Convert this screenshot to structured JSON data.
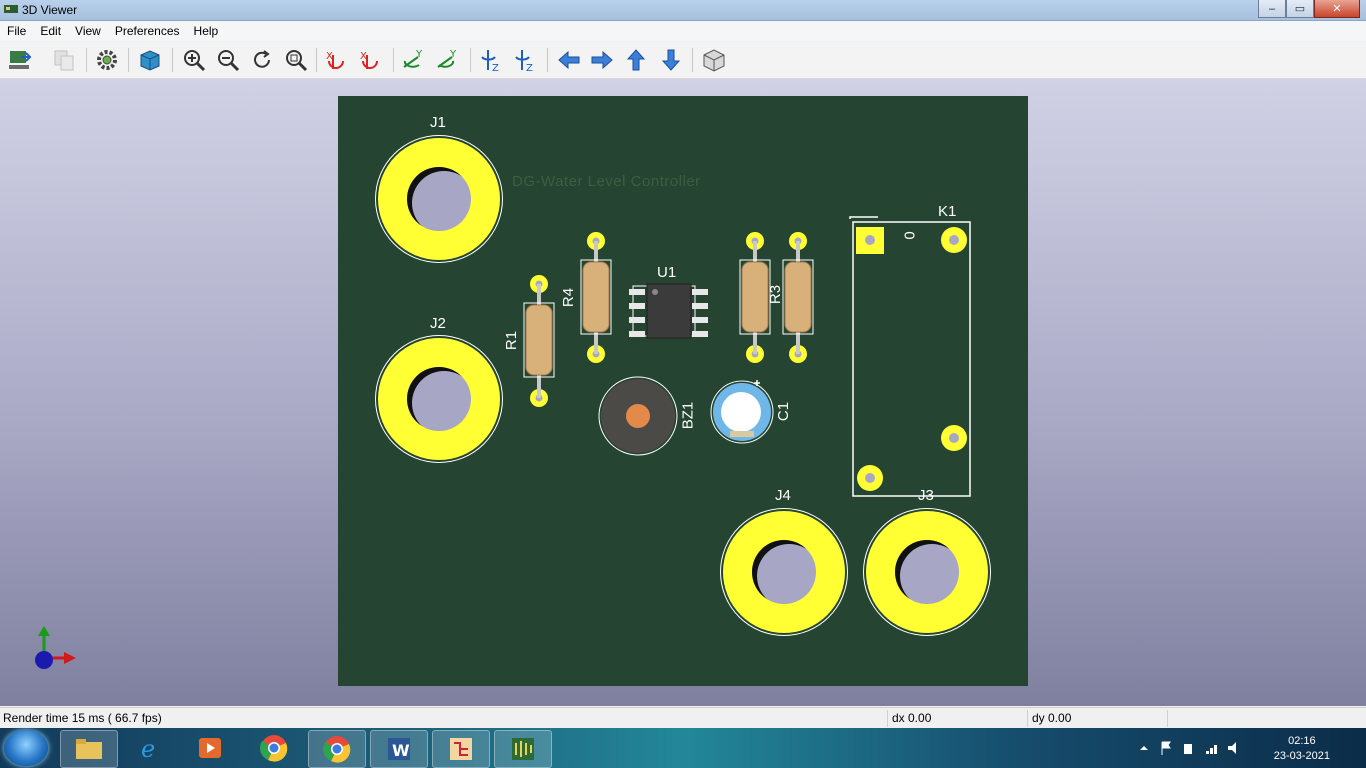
{
  "window": {
    "title": "3D Viewer",
    "controls": {
      "minimize": "–",
      "maximize": "▭",
      "close": "✕"
    }
  },
  "menu": [
    "File",
    "Edit",
    "View",
    "Preferences",
    "Help"
  ],
  "toolbar": [
    "reload-board-icon",
    "copy-image-icon",
    "settings-icon",
    "orthographic-view-icon",
    "zoom-in-icon",
    "zoom-out-icon",
    "redraw-icon",
    "zoom-fit-icon",
    "rotate-x-cw-icon",
    "rotate-x-ccw-icon",
    "rotate-y-cw-icon",
    "rotate-y-ccw-icon",
    "rotate-z-cw-icon",
    "rotate-z-ccw-icon",
    "move-left-icon",
    "move-right-icon",
    "move-up-icon",
    "move-down-icon",
    "view-3d-box-icon"
  ],
  "pcb": {
    "board_text": "DG-Water Level Controller",
    "refs": {
      "J1": "J1",
      "J2": "J2",
      "J3": "J3",
      "J4": "J4",
      "K1": "K1",
      "U1": "U1",
      "R1": "R1",
      "R4": "R4",
      "R3": "R3",
      "BZ1": "BZ1",
      "C1": "C1",
      "k1_pin": "0"
    },
    "colors": {
      "board": "#254431",
      "copper": "#ffff33",
      "silk": "#ffffff"
    }
  },
  "status": {
    "render_time": "Render time 15 ms ( 66.7 fps)",
    "dx": "dx 0.00",
    "dy": "dy 0.00"
  },
  "taskbar": {
    "time": "02:16",
    "date": "23-03-2021"
  }
}
